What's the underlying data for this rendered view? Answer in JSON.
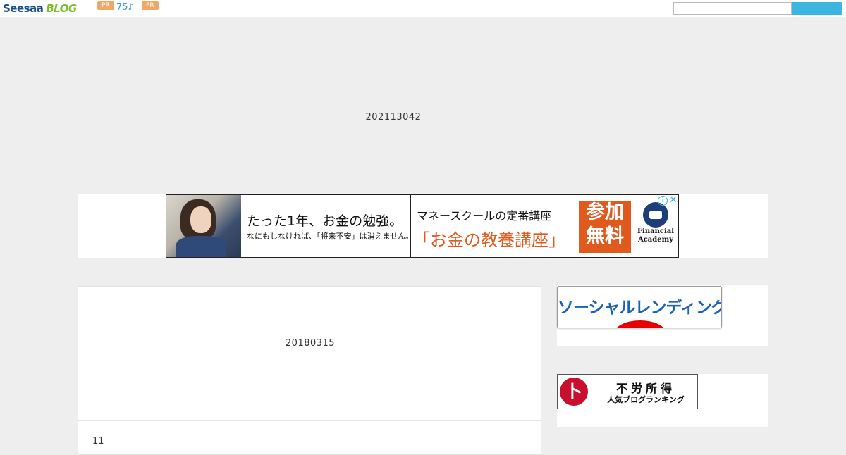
{
  "header": {
    "logo_main": "Seesaa",
    "logo_sub": "BLOG",
    "pr_badge_1": "PR",
    "music_count": "75♪",
    "pr_badge_2": "PR",
    "search": {
      "value": "",
      "placeholder": "",
      "button_label": ""
    }
  },
  "blog": {
    "title": "202113042"
  },
  "ad": {
    "headline": "たった1年、お金の勉強。",
    "subline": "なにもしなければ、「将来不安」は消えません。",
    "school": "マネースクールの定番講座",
    "course": "「お金の教養講座」",
    "free_line1": "参加",
    "free_line2": "無料",
    "brand_line1": "Financial",
    "brand_line2": "Academy",
    "info_icon": "info-icon",
    "close_icon": "close-icon"
  },
  "article": {
    "date": "20180315",
    "text": "11"
  },
  "sidebar": {
    "banner_social_label": "ソーシャルレンディング",
    "ranking_badge": "卜",
    "ranking_title": "不労所得",
    "ranking_sub": "人気ブログランキング"
  },
  "colors": {
    "background": "#eeeeee",
    "search_button": "#3cb6e0",
    "ad_accent": "#e05a1e",
    "pr_badge": "#f0a868"
  }
}
